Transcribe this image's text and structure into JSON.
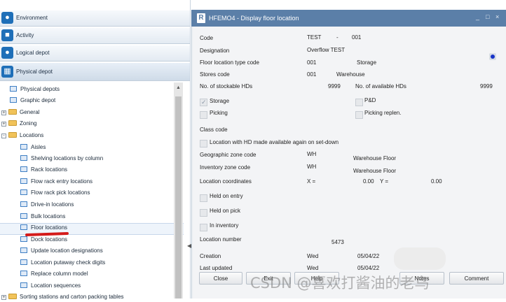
{
  "nav": {
    "sections": [
      {
        "label": "Environment",
        "icon": "globe-icon"
      },
      {
        "label": "Activity",
        "icon": "cube-icon"
      },
      {
        "label": "Logical depot",
        "icon": "people-icon"
      },
      {
        "label": "Physical depot",
        "icon": "warehouse-icon"
      }
    ],
    "tree": [
      {
        "label": "Physical depots",
        "kind": "leaf"
      },
      {
        "label": "Graphic depot",
        "kind": "leaf"
      },
      {
        "label": "General",
        "kind": "folder",
        "toggle": "+"
      },
      {
        "label": "Zoning",
        "kind": "folder",
        "toggle": "+"
      },
      {
        "label": "Locations",
        "kind": "folder",
        "toggle": "-"
      },
      {
        "label": "Aisles",
        "kind": "leaf"
      },
      {
        "label": "Shelving locations by column",
        "kind": "leaf"
      },
      {
        "label": "Rack locations",
        "kind": "leaf"
      },
      {
        "label": "Flow rack entry locations",
        "kind": "leaf"
      },
      {
        "label": "Flow rack pick locations",
        "kind": "leaf"
      },
      {
        "label": "Drive-in locations",
        "kind": "leaf"
      },
      {
        "label": "Bulk locations",
        "kind": "leaf"
      },
      {
        "label": "Floor locations",
        "kind": "leaf"
      },
      {
        "label": "Dock locations",
        "kind": "leaf"
      },
      {
        "label": "Update location designations",
        "kind": "leaf"
      },
      {
        "label": "Location putaway check digits",
        "kind": "leaf"
      },
      {
        "label": "Replace column model",
        "kind": "leaf"
      },
      {
        "label": "Location sequences",
        "kind": "leaf"
      },
      {
        "label": "Sorting stations and carton packing tables",
        "kind": "folder",
        "toggle": "+"
      }
    ],
    "selected": "Floor locations"
  },
  "window": {
    "logo": "R",
    "title": "HFEMO4 - Display floor location",
    "controls": [
      "_",
      "□",
      "×"
    ]
  },
  "form": {
    "code_label": "Code",
    "code_part1": "TEST",
    "code_sep": "-",
    "code_part2": "001",
    "designation_label": "Designation",
    "designation_value": "Overflow TEST",
    "type_label": "Floor location type code",
    "type_code": "001",
    "type_name": "Storage",
    "stores_label": "Stores code",
    "stores_code": "001",
    "stores_name": "Warehouse",
    "stockable_label": "No. of stockable HDs",
    "stockable_value": "9999",
    "available_label": "No. of available HDs",
    "available_value": "9999",
    "cb_storage": "Storage",
    "cb_pd": "P&D",
    "cb_picking": "Picking",
    "cb_replen": "Picking replen.",
    "class_label": "Class code",
    "cb_setdown": "Location with HD made available again on set-down",
    "geo_label": "Geographic zone code",
    "geo_code": "WH",
    "geo_name": "Warehouse Floor",
    "inv_label": "Inventory zone code",
    "inv_code": "WH",
    "inv_name": "Warehouse Floor",
    "coords_label": "Location coordinates",
    "x_label": "X =",
    "x_value": "0.00",
    "y_label": "Y =",
    "y_value": "0.00",
    "cb_entry": "Held on entry",
    "cb_pick": "Held on pick",
    "cb_inventory": "In inventory",
    "number_label": "Location number",
    "number_value": "5473",
    "creation_label": "Creation",
    "creation_day": "Wed",
    "creation_date": "05/04/22",
    "updated_label": "Last updated",
    "updated_day": "Wed",
    "updated_date": "05/04/22"
  },
  "buttons": {
    "close": "Close",
    "exit": "Exit",
    "help": "Help",
    "notes": "Notes",
    "comment": "Comment"
  },
  "watermark": "CSDN @喜欢打酱油的老鸟"
}
